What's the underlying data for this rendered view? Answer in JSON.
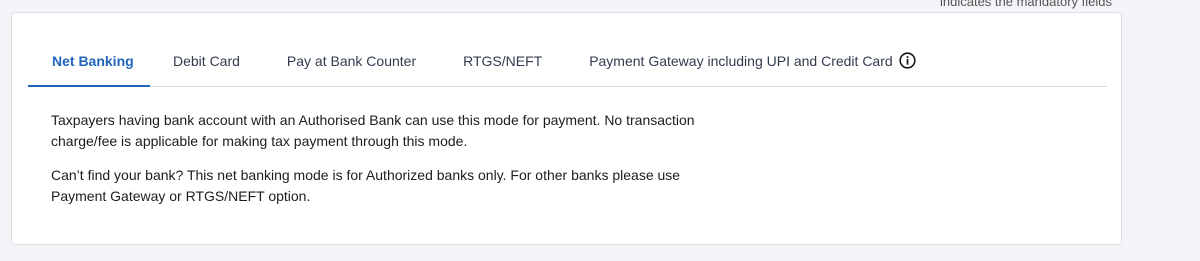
{
  "header": {
    "mandatory_note": "indicates the mandatory fields"
  },
  "tabs": [
    {
      "label": "Net Banking",
      "active": true
    },
    {
      "label": "Debit Card",
      "active": false
    },
    {
      "label": "Pay at Bank Counter",
      "active": false
    },
    {
      "label": "RTGS/NEFT",
      "active": false
    },
    {
      "label": "Payment Gateway including UPI and Credit Card",
      "active": false
    }
  ],
  "content": {
    "paragraph_1": "Taxpayers having bank account with an Authorised Bank can use this mode for payment. No transaction charge/fee is applicable for making tax payment through this mode.",
    "paragraph_2": "Can’t find your bank? This net banking mode is for Authorized banks only. For other banks please use Payment Gateway or RTGS/NEFT option."
  },
  "colors": {
    "accent": "#1f65b9",
    "text": "#333c4e",
    "background": "#f3f4f7"
  },
  "icons": {
    "gateway_info": "info-icon"
  }
}
